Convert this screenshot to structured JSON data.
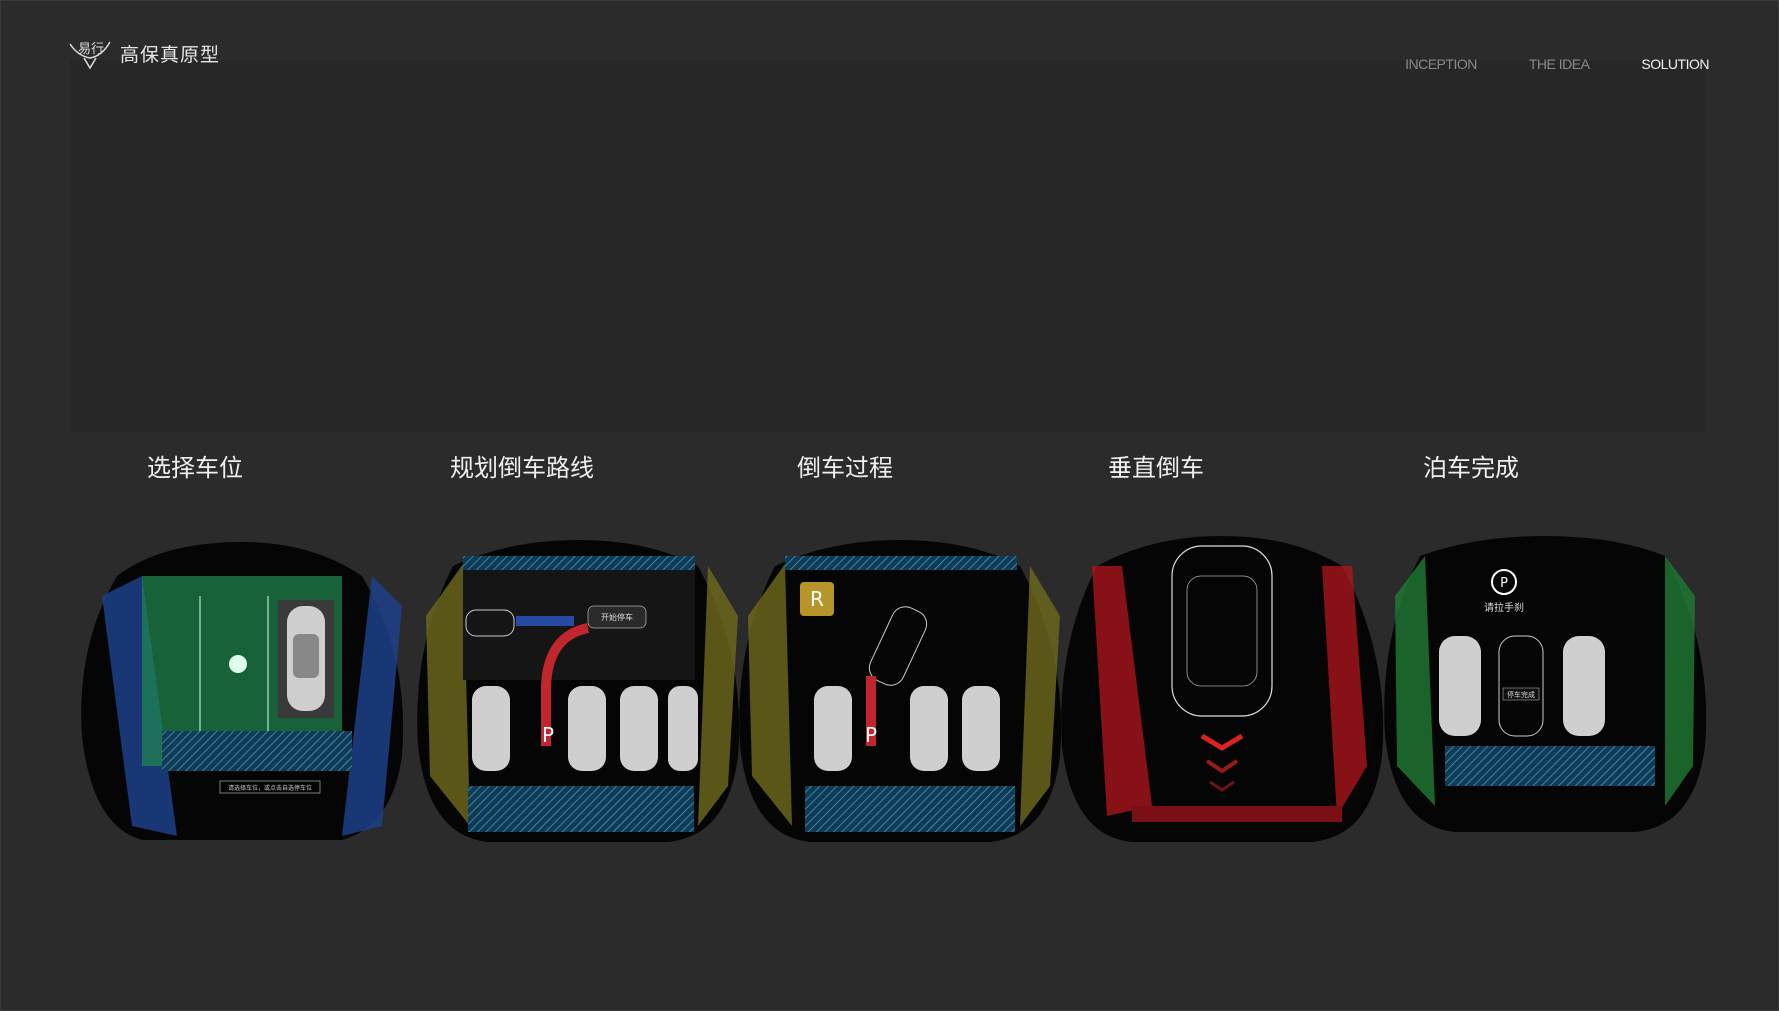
{
  "logo": {
    "mark_text": "易行",
    "name": "高保真原型"
  },
  "nav": {
    "items": [
      "INCEPTION",
      "THE IDEA",
      "SOLUTION"
    ],
    "active": "SOLUTION"
  },
  "steps": [
    {
      "title": "选择车位",
      "caption": "请选择车位，或点击自选停车位"
    },
    {
      "title": "规划倒车路线",
      "button": "开始停车",
      "marker": "P"
    },
    {
      "title": "倒车过程",
      "gear": "R",
      "marker": "P"
    },
    {
      "title": "垂直倒车"
    },
    {
      "title": "泊车完成",
      "status": "请拉手刹",
      "badge": "停车完成",
      "icon": "parking-brake-icon"
    }
  ],
  "colors": {
    "background": "#2b2b2b",
    "green": "#1f8a4f",
    "blue": "#1d3f8a",
    "olive": "#6e6a1c",
    "red": "#b3161c",
    "stripe": "#3aa6d6"
  }
}
